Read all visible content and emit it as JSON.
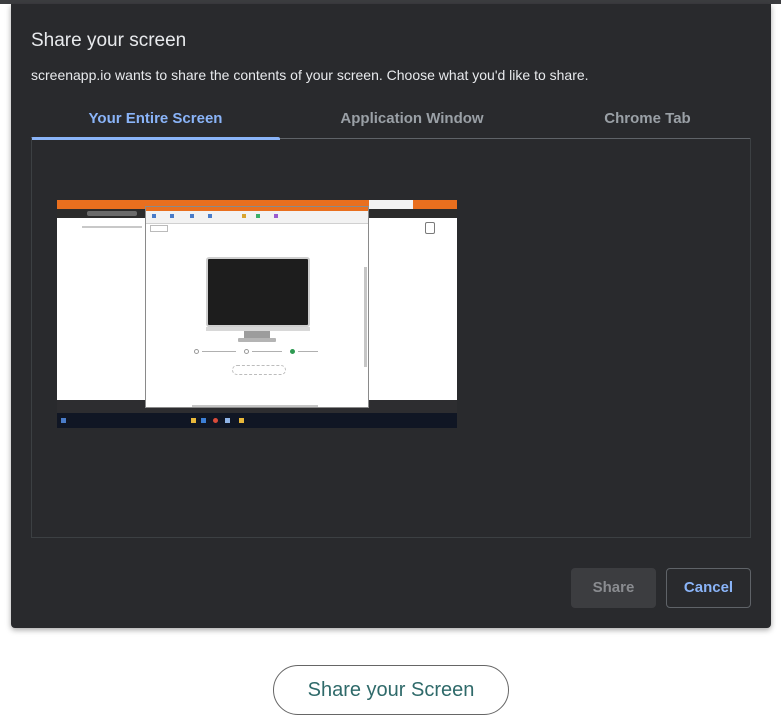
{
  "dialog": {
    "title": "Share your screen",
    "description": "screenapp.io wants to share the contents of your screen. Choose what you'd like to share.",
    "tabs": [
      {
        "label": "Your Entire Screen",
        "active": true
      },
      {
        "label": "Application Window",
        "active": false
      },
      {
        "label": "Chrome Tab",
        "active": false
      }
    ],
    "preview": {
      "icon": "screen-thumbnail"
    },
    "buttons": {
      "share_label": "Share",
      "share_enabled": false,
      "cancel_label": "Cancel"
    }
  },
  "page": {
    "share_button_label": "Share your Screen"
  },
  "colors": {
    "dialog_bg": "#292a2d",
    "accent": "#8ab4f8",
    "text": "#e8eaed",
    "inactive_tab": "#9aa0a6",
    "page_button_text": "#2f6a6a"
  }
}
